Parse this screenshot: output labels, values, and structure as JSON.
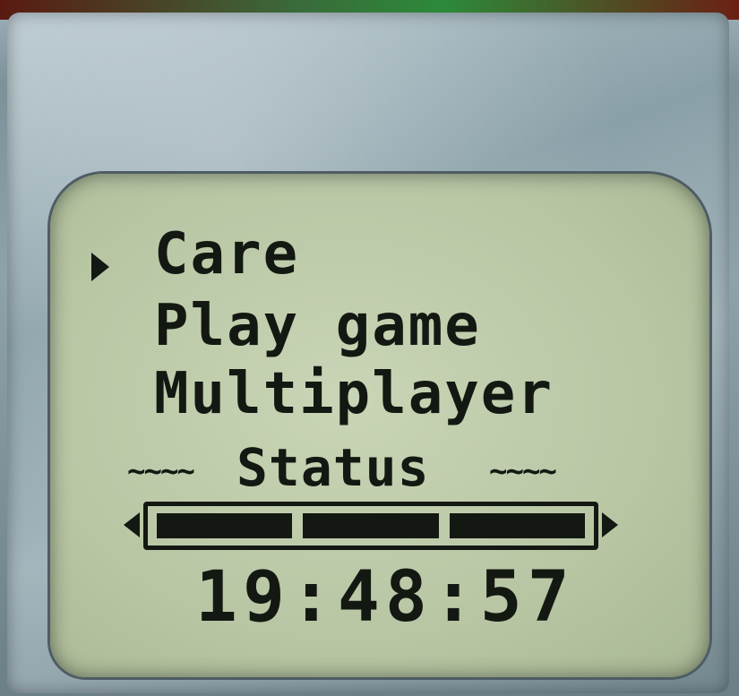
{
  "menu": {
    "items": [
      {
        "label": "Care",
        "selected": true
      },
      {
        "label": "Play game",
        "selected": false
      },
      {
        "label": "Multiplayer",
        "selected": false
      }
    ],
    "cursor_icon": "triangle-right-icon"
  },
  "status": {
    "tildes_left": "~~~~",
    "label": "Status",
    "tildes_right": "~~~~",
    "bar_segments_filled": 3,
    "bar_segments_total": 3,
    "level": 1.0
  },
  "clock": {
    "time": "19:48:57"
  },
  "colors": {
    "lcd_background": "#b8c6a4",
    "lcd_ink": "#141812",
    "bezel": "#8aa0a8"
  }
}
